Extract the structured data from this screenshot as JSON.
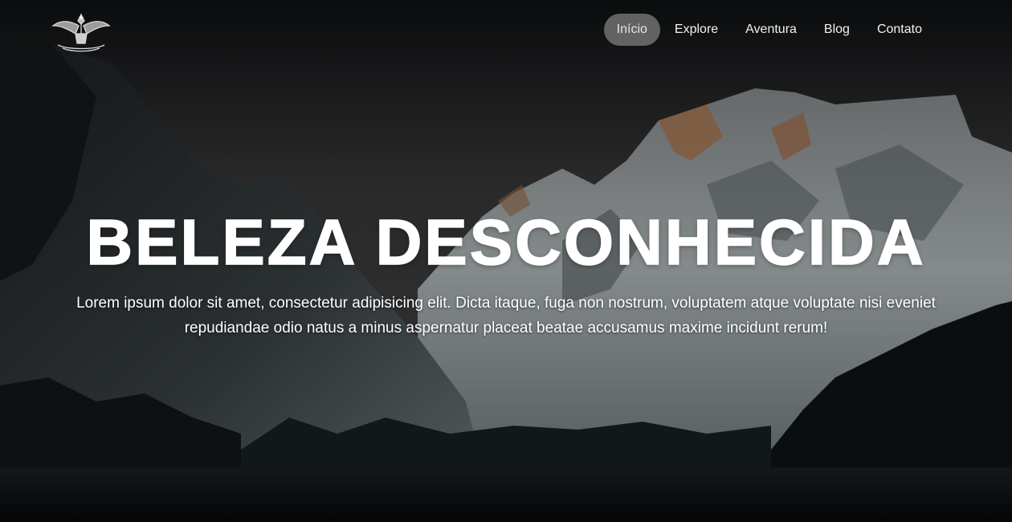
{
  "nav": {
    "logo_icon": "eagle-crest-icon",
    "links": [
      {
        "label": "Início",
        "active": true
      },
      {
        "label": "Explore",
        "active": false
      },
      {
        "label": "Aventura",
        "active": false
      },
      {
        "label": "Blog",
        "active": false
      },
      {
        "label": "Contato",
        "active": false
      }
    ]
  },
  "hero": {
    "title": "BELEZA DESCONHECIDA",
    "description": "Lorem ipsum dolor sit amet, consectetur adipisicing elit. Dicta itaque, fuga non nostrum, voluptatem atque voluptate nisi eveniet repudiandae odio natus a minus aspernatur placeat beatae accusamus maxime incidunt rerum!"
  },
  "colors": {
    "text": "#ffffff",
    "nav_active_bg": "#969696",
    "background_dark": "#0b0d10"
  }
}
